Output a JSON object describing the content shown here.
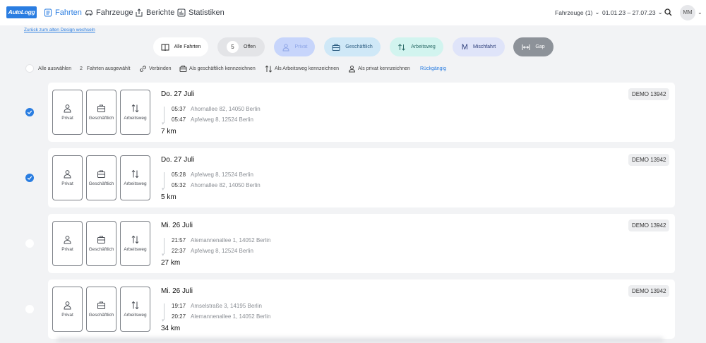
{
  "header": {
    "logo": "AutoLogg",
    "nav": [
      "Fahrten",
      "Fahrzeuge",
      "Berichte",
      "Statistiken"
    ],
    "vehicles": "Fahrzeuge (1)",
    "date_range": "01.01.23 – 27.07.23",
    "user_initials": "MM"
  },
  "back_link": "Zurück zum alten Design wechseln",
  "filters": {
    "all": "Alle Fahrten",
    "open_count": "5",
    "open": "Offen",
    "private": "Privat",
    "business": "Geschäftlich",
    "commute": "Arbeitsweg",
    "mixed": "Mischfahrt",
    "gap": "Gap"
  },
  "toolbar": {
    "select_all": "Alle auswählen",
    "selected_count": "2",
    "selected_label": "Fahrten ausgewählt",
    "connect": "Verbinden",
    "mark_business": "Als geschäftlich kennzeichnen",
    "mark_commute": "Als Arbeitsweg kennzeichnen",
    "mark_private": "Als privat kennzeichnen",
    "undo": "Rückgängig"
  },
  "category_labels": {
    "private": "Privat",
    "business": "Geschäftlich",
    "commute": "Arbeitsweg"
  },
  "trips": [
    {
      "selected": true,
      "date": "Do. 27 Juli",
      "start_time": "05:37",
      "start_addr": "Ahornallee 82, 14050 Berlin",
      "end_time": "05:47",
      "end_addr": "Apfelweg 8, 12524 Berlin",
      "distance": "7 km",
      "vehicle": "DEMO 13942"
    },
    {
      "selected": true,
      "date": "Do. 27 Juli",
      "start_time": "05:28",
      "start_addr": "Apfelweg 8, 12524 Berlin",
      "end_time": "05:32",
      "end_addr": "Ahornallee 82, 14050 Berlin",
      "distance": "5 km",
      "vehicle": "DEMO 13942"
    },
    {
      "selected": false,
      "date": "Mi. 26 Juli",
      "start_time": "21:57",
      "start_addr": "Alemannenallee 1, 14052 Berlin",
      "end_time": "22:37",
      "end_addr": "Apfelweg 8, 12524 Berlin",
      "distance": "27 km",
      "vehicle": "DEMO 13942"
    },
    {
      "selected": false,
      "date": "Mi. 26 Juli",
      "start_time": "19:17",
      "start_addr": "Amselstraße 3, 14195 Berlin",
      "end_time": "20:27",
      "end_addr": "Alemannenallee 1, 14052 Berlin",
      "distance": "34 km",
      "vehicle": "DEMO 13942"
    }
  ],
  "colors": {
    "accent": "#2a7de1",
    "private_pill": "#c7d5fb",
    "business_pill": "#cfe8f7",
    "commute_pill": "#d2f4ef",
    "mixed_pill": "#dfe4f9",
    "gap_pill": "#8d9299"
  }
}
